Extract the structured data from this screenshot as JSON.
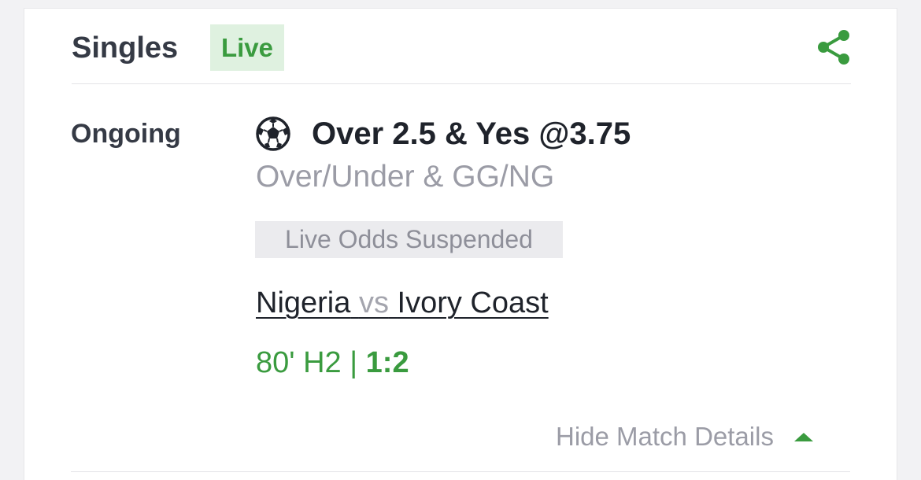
{
  "header": {
    "title": "Singles",
    "live_badge": "Live"
  },
  "bet": {
    "status": "Ongoing",
    "sport_icon": "soccer-ball-icon",
    "selection": "Over 2.5 & Yes @3.75",
    "market": "Over/Under & GG/NG",
    "odds_notice": "Live Odds Suspended",
    "home_team": "Nigeria",
    "vs": "vs",
    "away_team": "Ivory Coast",
    "match_time": "80' H2 |",
    "score": "1:2",
    "toggle_label": "Hide Match Details"
  },
  "colors": {
    "accent_green": "#3a9b3f",
    "live_badge_bg": "#dff1e0",
    "suspended_bg": "#ebebee",
    "muted_text": "#9b9ca6",
    "primary_text": "#1f232b"
  }
}
